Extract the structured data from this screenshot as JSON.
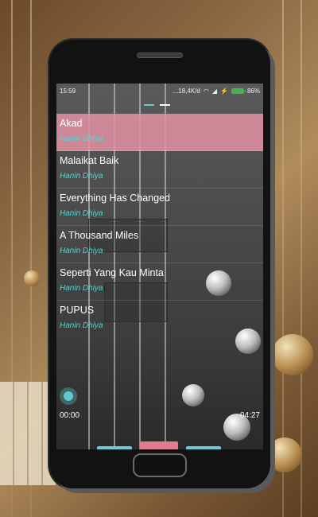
{
  "status_bar": {
    "time": "15:59",
    "network_speed": "...18,4K/d",
    "battery_percent": "86%"
  },
  "playlist": [
    {
      "title": "Akad",
      "artist": "Hanin Dhiya",
      "active": true
    },
    {
      "title": "Malaikat Baik",
      "artist": "Hanin Dhiya",
      "active": false
    },
    {
      "title": "Everything Has Changed",
      "artist": "Hanin Dhiya",
      "active": false
    },
    {
      "title": "A Thousand Miles",
      "artist": "Hanin Dhiya",
      "active": false
    },
    {
      "title": "Seperti Yang Kau Minta",
      "artist": "Hanin Dhiya",
      "active": false
    },
    {
      "title": "PUPUS",
      "artist": "Hanin Dhiya",
      "active": false
    }
  ],
  "player": {
    "current_time": "00:00",
    "total_time": "04:27",
    "progress": 0
  },
  "icons": {
    "prev": "rewind-icon",
    "play": "pause-icon",
    "next": "fast-forward-icon",
    "shuffle": "shuffle-icon",
    "repeat": "repeat-icon"
  },
  "colors": {
    "accent": "#5fc9cf",
    "active_row": "#e3929f",
    "play_button": "#e07b93",
    "artist_text": "#57d3d3"
  }
}
